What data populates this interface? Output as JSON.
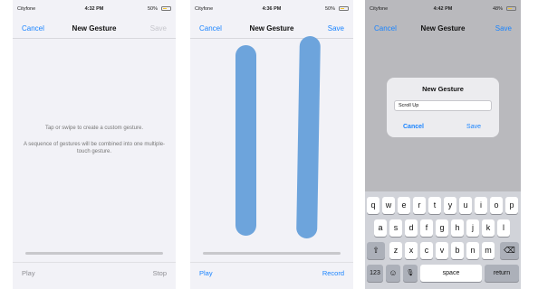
{
  "screens": [
    {
      "status": {
        "carrier": "Cityfone",
        "time": "4:32 PM",
        "battery": "50%",
        "battery_level": 0.5
      },
      "nav": {
        "left": "Cancel",
        "title": "New Gesture",
        "right": "Save",
        "right_enabled": false
      },
      "hint_line1": "Tap or swipe to create a custom gesture.",
      "hint_line2": "A sequence of gestures will be combined into one multiple-touch gesture.",
      "bottom": {
        "left": "Play",
        "right": "Stop"
      }
    },
    {
      "status": {
        "carrier": "Cityfone",
        "time": "4:36 PM",
        "battery": "50%",
        "battery_level": 0.5
      },
      "nav": {
        "left": "Cancel",
        "title": "New Gesture",
        "right": "Save",
        "right_enabled": true
      },
      "bottom": {
        "left": "Play",
        "right": "Record"
      }
    },
    {
      "status": {
        "carrier": "Cityfone",
        "time": "4:42 PM",
        "battery": "48%",
        "battery_level": 0.48
      },
      "nav": {
        "left": "Cancel",
        "title": "New Gesture",
        "right": "Save"
      },
      "dialog": {
        "title": "New Gesture",
        "field_value": "Scroll Up",
        "cancel": "Cancel",
        "save": "Save"
      },
      "keyboard": {
        "row1": [
          "q",
          "w",
          "e",
          "r",
          "t",
          "y",
          "u",
          "i",
          "o",
          "p"
        ],
        "row2": [
          "a",
          "s",
          "d",
          "f",
          "g",
          "h",
          "j",
          "k",
          "l"
        ],
        "row3": [
          "z",
          "x",
          "c",
          "v",
          "b",
          "n",
          "m"
        ],
        "shift": "⇧",
        "delete": "⌫",
        "numbers": "123",
        "emoji": "☺",
        "mic": "🎙",
        "space": "space",
        "return": "return"
      }
    }
  ],
  "colors": {
    "accent": "#1a84ff",
    "stroke": "#6da4dc",
    "battery": "#f5c52b"
  }
}
